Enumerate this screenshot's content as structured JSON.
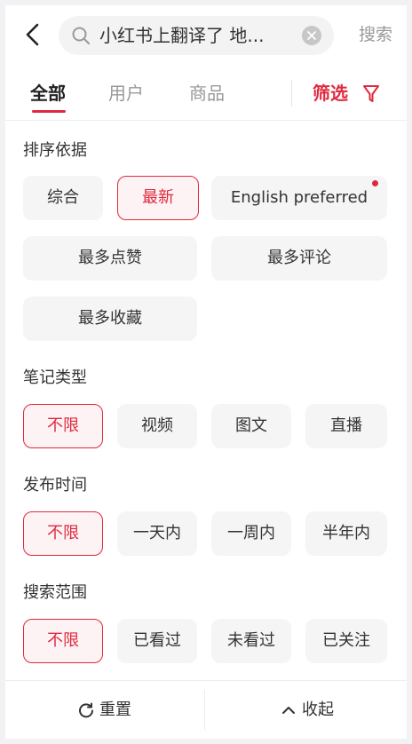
{
  "search": {
    "query": "小红书上翻译了 地...",
    "button_label": "搜索"
  },
  "tabs": [
    {
      "label": "全部",
      "active": true
    },
    {
      "label": "用户",
      "active": false
    },
    {
      "label": "商品",
      "active": false
    }
  ],
  "filter_label": "筛选",
  "accent_color": "#e0293e",
  "sections": {
    "sort": {
      "title": "排序依据",
      "options": [
        "综合",
        "最新",
        "English preferred",
        "最多点赞",
        "最多评论",
        "最多收藏"
      ],
      "selected": "最新"
    },
    "note_type": {
      "title": "笔记类型",
      "options": [
        "不限",
        "视频",
        "图文",
        "直播"
      ],
      "selected": "不限"
    },
    "publish_time": {
      "title": "发布时间",
      "options": [
        "不限",
        "一天内",
        "一周内",
        "半年内"
      ],
      "selected": "不限"
    },
    "search_scope": {
      "title": "搜索范围",
      "options": [
        "不限",
        "已看过",
        "未看过",
        "已关注"
      ],
      "selected": "不限"
    }
  },
  "footer": {
    "reset_label": "重置",
    "collapse_label": "收起"
  }
}
